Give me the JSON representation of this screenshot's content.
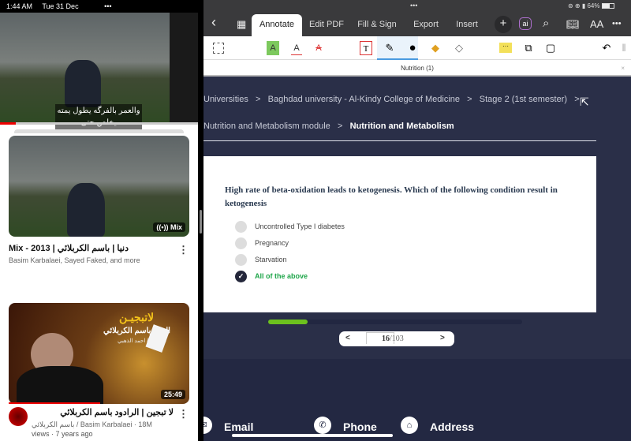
{
  "left_pane": {
    "status": {
      "time": "1:44 AM",
      "date": "Tue 31 Dec",
      "dots": "•••"
    },
    "player": {
      "subtitle_line1": "والعمر بالفرگه يطول يمته",
      "subtitle_line2": "يخلص حتى"
    },
    "videos": [
      {
        "title": "Mix - 2013 | دنيا | باسم الكربلائي",
        "subtitle": "Basim Karbalaei, Sayed Faked, and more",
        "badge": "Mix",
        "badge_icon": "radio-waves-icon",
        "menu": "⋮"
      },
      {
        "title": "لا تبجين | الرادود باسم الكربلائي",
        "subtitle": "باسم الكربلائي / Basim Karbalaei · 18M",
        "subtitle2": "views · 7 years ago",
        "duration": "25:49",
        "thumb_title": "لاتبجيـن",
        "thumb_sub1": "الحاج باسم الكربلائي",
        "thumb_sub2": "للشاعر / احمد الذهبي",
        "menu": "⋮"
      }
    ]
  },
  "right_pane": {
    "status": {
      "dots": "•••",
      "battery": "64%"
    },
    "tabs": [
      "Annotate",
      "Edit PDF",
      "Fill & Sign",
      "Export",
      "Insert"
    ],
    "active_tab": "Annotate",
    "icons": {
      "back": "‹",
      "grid": "grid-icon",
      "plus": "+",
      "ai": "ai",
      "search": "⌕",
      "book": "book-icon",
      "text_size": "AA",
      "more": "•••"
    },
    "document_title": "Nutrition (1)",
    "breadcrumb": [
      "Universities",
      "Baghdad university - Al-Kindy College of Medicine",
      "Stage 2 (1st semester)",
      "Nutrition and Metabolism module",
      "Nutrition and Metabolism"
    ],
    "separator": ">",
    "question": "High rate of beta-oxidation leads to ketogenesis. Which of the following condition result in ketogenesis",
    "options": [
      {
        "label": "Uncontrolled Type I diabetes",
        "selected": false
      },
      {
        "label": "Pregnancy",
        "selected": false
      },
      {
        "label": "Starvation",
        "selected": false
      },
      {
        "label": "All of the above",
        "selected": true
      }
    ],
    "progress_percent": 15.5,
    "pager": {
      "prev": "<",
      "current": "16",
      "total": "/103",
      "next": ">"
    },
    "footer": {
      "email": "Email",
      "phone": "Phone",
      "address": "Address"
    },
    "colors": {
      "accent_green": "#6cc11e",
      "correct": "#1fa64a",
      "page_bg": "#2a2f48"
    }
  }
}
